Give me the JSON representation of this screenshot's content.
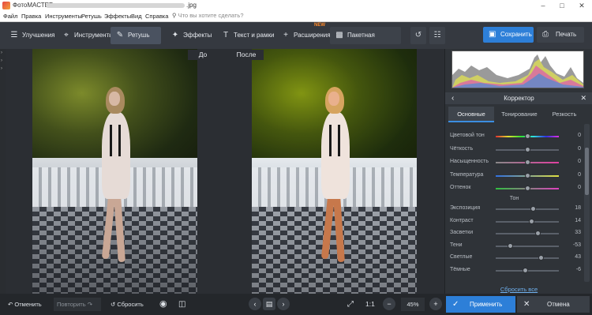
{
  "titlebar": {
    "app_name": "ФотоМАСТЕР",
    "file_ext": ".jpg"
  },
  "menu": {
    "items": [
      "Файл",
      "Правка",
      "Инструменты",
      "Ретушь",
      "Эффекты",
      "Вид",
      "Справка"
    ],
    "search_placeholder": "Что вы хотите сделать?"
  },
  "toolbar": {
    "tabs": [
      {
        "label": "Улучшения",
        "icon": "sliders-icon"
      },
      {
        "label": "Инструменты",
        "icon": "crop-icon"
      },
      {
        "label": "Ретушь",
        "icon": "brush-icon"
      },
      {
        "label": "Эффекты",
        "icon": "sparkle-icon"
      },
      {
        "label": "Текст и рамки",
        "icon": "text-icon"
      },
      {
        "label": "Расширения",
        "icon": "plus-icon",
        "badge": "NEW"
      },
      {
        "label": "Пакетная обработка",
        "icon": "batch-icon"
      }
    ],
    "active_tab": "Ретушь",
    "save_label": "Сохранить",
    "print_label": "Печать"
  },
  "compare": {
    "before_label": "До",
    "after_label": "После"
  },
  "panel": {
    "title": "Корректор",
    "tabs": [
      "Основные",
      "Тонирование",
      "Резкость"
    ],
    "active_tab": "Основные",
    "color_sliders": [
      {
        "label": "Цветовой тон",
        "value": "0",
        "level": 0.5,
        "track": "hue"
      },
      {
        "label": "Чёткость",
        "value": "0",
        "level": 0.5,
        "track": "plain"
      },
      {
        "label": "Насыщенность",
        "value": "0",
        "level": 0.5,
        "track": "sat"
      },
      {
        "label": "Температура",
        "value": "0",
        "level": 0.5,
        "track": "temp"
      },
      {
        "label": "Оттенок",
        "value": "0",
        "level": 0.5,
        "track": "tint"
      }
    ],
    "tone_label": "Тон",
    "tone_sliders": [
      {
        "label": "Экспозиция",
        "value": "18",
        "level": 0.59
      },
      {
        "label": "Контраст",
        "value": "14",
        "level": 0.57
      },
      {
        "label": "Засветки",
        "value": "33",
        "level": 0.665
      },
      {
        "label": "Тени",
        "value": "-53",
        "level": 0.235
      },
      {
        "label": "Светлые",
        "value": "43",
        "level": 0.715
      },
      {
        "label": "Тёмные",
        "value": "-6",
        "level": 0.47
      }
    ],
    "reset_all": "Сбросить все"
  },
  "bottom": {
    "undo": "Отменить",
    "redo": "Повторить",
    "reset": "Сбросить",
    "zoom_ratio": "1:1",
    "zoom": "45%",
    "apply": "Применить",
    "cancel": "Отмена"
  },
  "colors": {
    "accent": "#2d7fd8",
    "badge": "#ff8a2a",
    "link": "#6fb0ee"
  }
}
